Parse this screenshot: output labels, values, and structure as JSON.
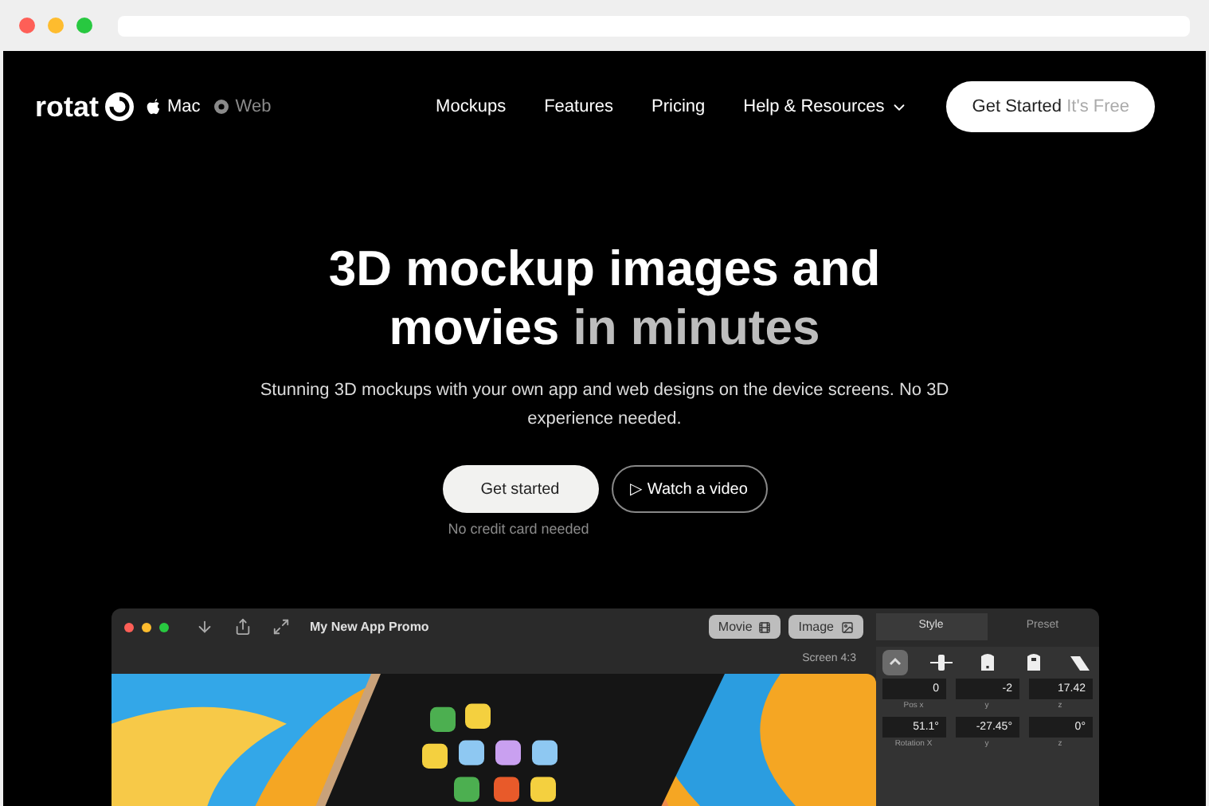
{
  "nav": {
    "logo": "rotat",
    "platforms": [
      {
        "kind": "mac",
        "label": "Mac",
        "selected": true
      },
      {
        "kind": "web",
        "label": "Web",
        "selected": false
      }
    ],
    "links": [
      {
        "label": "Mockups",
        "dropdown": false
      },
      {
        "label": "Features",
        "dropdown": false
      },
      {
        "label": "Pricing",
        "dropdown": false
      },
      {
        "label": "Help & Resources",
        "dropdown": true
      }
    ],
    "cta": {
      "label": "Get Started",
      "note": "It's Free"
    }
  },
  "hero": {
    "title": "3D mockup images and movies",
    "title_accent": "in minutes",
    "subtitle": "Stunning 3D mockups with your own app and web designs on the device screens. No 3D experience needed.",
    "primary_button": "Get started",
    "video_button": "▷ Watch a video",
    "note": "No credit card needed"
  },
  "app": {
    "title": "My New App Promo",
    "export_buttons": [
      "Movie",
      "Image"
    ],
    "tabs": [
      {
        "label": "Style",
        "selected": true
      },
      {
        "label": "Preset",
        "selected": false
      }
    ],
    "screen_label": "Screen 4:3",
    "tools": [
      {
        "kind": "collapse",
        "selected": true
      },
      {
        "kind": "align",
        "selected": false
      },
      {
        "kind": "device-front",
        "selected": false
      },
      {
        "kind": "device-back",
        "selected": false
      },
      {
        "kind": "device-side",
        "selected": false
      }
    ],
    "field_rows": [
      {
        "fields": [
          {
            "value": "0",
            "label": "Pos x"
          },
          {
            "value": "-2",
            "label": "y"
          },
          {
            "value": "17.42",
            "label": "z"
          }
        ]
      },
      {
        "fields": [
          {
            "value": "51.1°",
            "label": "Rotation X"
          },
          {
            "value": "-27.45°",
            "label": "y"
          },
          {
            "value": "0°",
            "label": "z"
          }
        ]
      }
    ]
  }
}
